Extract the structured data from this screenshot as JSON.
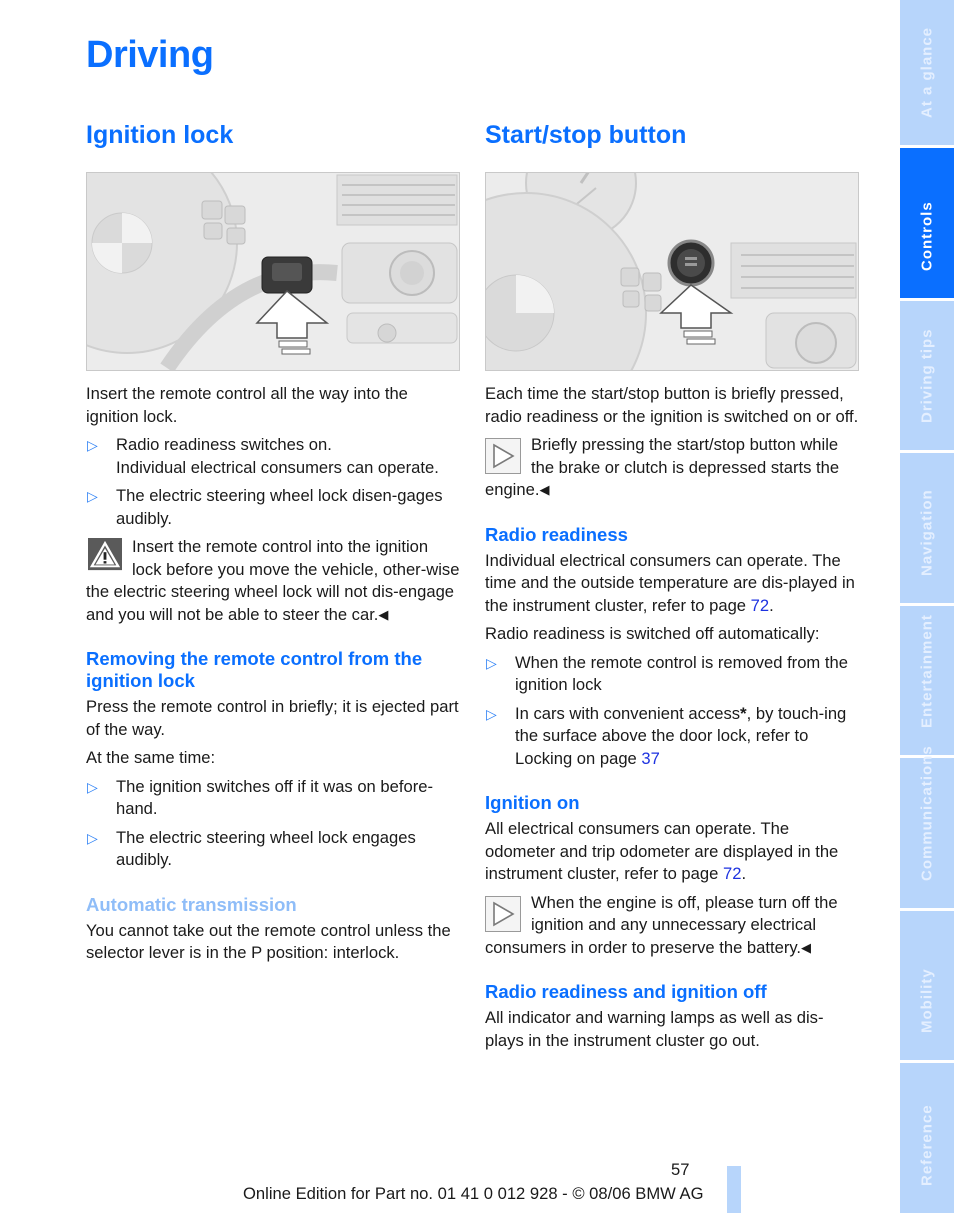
{
  "page": {
    "title": "Driving",
    "number": "57",
    "footer": "Online Edition for Part no. 01 41 0 012 928 - © 08/06 BMW AG"
  },
  "colors": {
    "accent": "#0a6fff",
    "accent_light": "#8fbdf8",
    "tab_inactive": "#b7d5fb",
    "link": "#1d32e0"
  },
  "sidebar": {
    "tabs": [
      {
        "label": "At a glance",
        "active": false
      },
      {
        "label": "Controls",
        "active": true
      },
      {
        "label": "Driving tips",
        "active": false
      },
      {
        "label": "Navigation",
        "active": false
      },
      {
        "label": "Entertainment",
        "active": false
      },
      {
        "label": "Communications",
        "active": false
      },
      {
        "label": "Mobility",
        "active": false
      },
      {
        "label": "Reference",
        "active": false
      }
    ]
  },
  "left": {
    "heading": "Ignition lock",
    "figure_alt": "Remote control being inserted into ignition lock next to steering wheel",
    "intro": "Insert the remote control all the way into the ignition lock.",
    "bullets": [
      {
        "line1": "Radio readiness switches on.",
        "line2": "Individual electrical consumers can operate."
      },
      {
        "line1": "The electric steering wheel lock disen-gages audibly."
      }
    ],
    "warning": {
      "icon": "warning-triangle-icon",
      "text": "Insert the remote control into the ignition lock before you move the vehicle, other-wise the electric steering wheel lock will not dis-engage and you will not be able to steer the car.",
      "end": "◀"
    },
    "removing": {
      "heading": "Removing the remote control from the ignition lock",
      "p1": "Press the remote control in briefly; it is ejected part of the way.",
      "p2": "At the same time:",
      "bullets": [
        "The ignition switches off if it was on before-hand.",
        "The electric steering wheel lock engages audibly."
      ]
    },
    "automatic": {
      "heading": "Automatic transmission",
      "text": "You cannot take out the remote control unless the selector lever is in the P position: interlock."
    }
  },
  "right": {
    "heading": "Start/stop button",
    "figure_alt": "Start/stop button on dashboard to the right of steering wheel",
    "intro": "Each time the start/stop button is briefly pressed, radio readiness or the ignition is switched on or off.",
    "note1": {
      "icon": "note-arrow-icon",
      "text": "Briefly pressing the start/stop button while the brake or clutch is depressed starts the engine.",
      "end": "◀"
    },
    "radio_readiness": {
      "heading": "Radio readiness",
      "p1_text": "Individual electrical consumers can operate. The time and the outside temperature are dis-played in the instrument cluster, refer to page ",
      "p1_link": "72",
      "p1_end": ".",
      "p2": "Radio readiness is switched off automatically:",
      "bullet1": "When the remote control is removed from the ignition lock",
      "bullet2_text": "In cars with convenient access",
      "bullet2_star": "*",
      "bullet2_rest": ", by touch-ing the surface above the door lock, refer to Locking on page ",
      "bullet2_link": "37"
    },
    "ignition_on": {
      "heading": "Ignition on",
      "p_text": "All electrical consumers can operate. The odometer and trip odometer are displayed in the instrument cluster, refer to page ",
      "p_link": "72",
      "p_end": "."
    },
    "note2": {
      "icon": "note-arrow-icon",
      "text": "When the engine is off, please turn off the ignition and any unnecessary electrical consumers in order to preserve the battery.",
      "end": "◀"
    },
    "off": {
      "heading": "Radio readiness and ignition off",
      "text": "All indicator and warning lamps as well as dis-plays in the instrument cluster go out."
    }
  },
  "bullet_marker": "▷"
}
